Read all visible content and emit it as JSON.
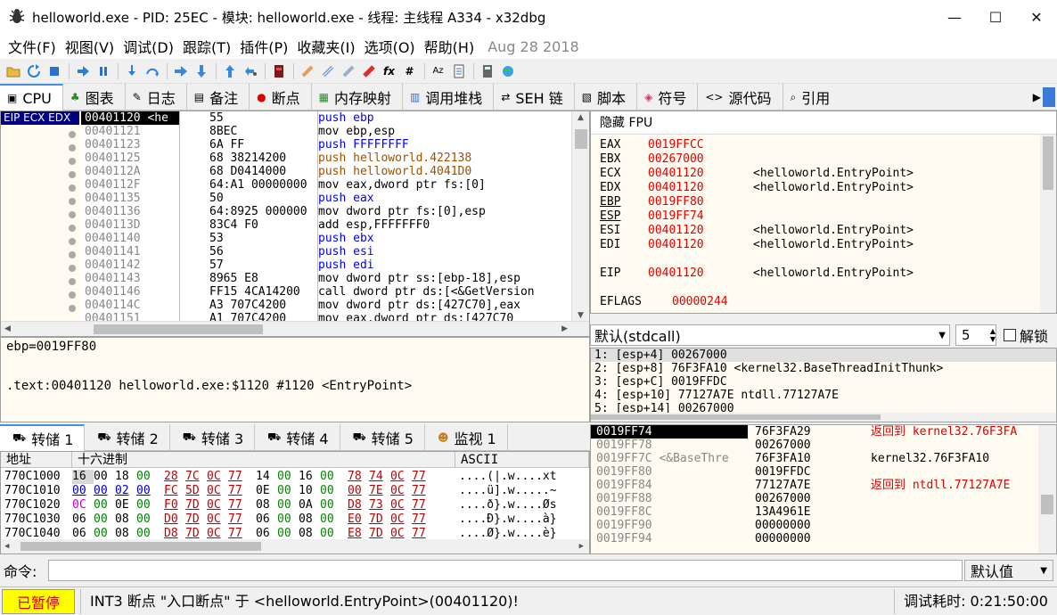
{
  "window": {
    "title": "helloworld.exe - PID: 25EC - 模块: helloworld.exe - 线程: 主线程 A334 - x32dbg",
    "minimize": "—",
    "maximize": "☐",
    "close": "✕"
  },
  "menu": {
    "items": [
      "文件(F)",
      "视图(V)",
      "调试(D)",
      "跟踪(T)",
      "插件(P)",
      "收藏夹(I)",
      "选项(O)",
      "帮助(H)"
    ],
    "date": "Aug 28 2018"
  },
  "toolbar": {
    "fx": "fx",
    "hash": "#",
    "az": "Aᴢ"
  },
  "tabs": [
    {
      "label": "CPU",
      "icon": "▣"
    },
    {
      "label": "图表",
      "icon": "♣"
    },
    {
      "label": "日志",
      "icon": "✎"
    },
    {
      "label": "备注",
      "icon": "▤"
    },
    {
      "label": "断点",
      "icon": "●"
    },
    {
      "label": "内存映射",
      "icon": "▦"
    },
    {
      "label": "调用堆栈",
      "icon": "▥"
    },
    {
      "label": "SEH 链",
      "icon": "⇄"
    },
    {
      "label": "脚本",
      "icon": "▧"
    },
    {
      "label": "符号",
      "icon": "◈"
    },
    {
      "label": "源代码",
      "icon": "<>"
    },
    {
      "label": "引用",
      "icon": "⌕"
    }
  ],
  "cpu": {
    "eip_label": "EIP ECX EDX",
    "rows": [
      {
        "addr": "00401120 <he",
        "bytes": "55",
        "asm": "push ebp"
      },
      {
        "addr": "00401121",
        "bytes": "8BEC",
        "asm": "mov ebp,esp"
      },
      {
        "addr": "00401123",
        "bytes": "6A FF",
        "asm": "push FFFFFFFF"
      },
      {
        "addr": "00401125",
        "bytes": "68 38214200",
        "asm": "push helloworld.422138"
      },
      {
        "addr": "0040112A",
        "bytes": "68 D0414000",
        "asm": "push helloworld.4041D0"
      },
      {
        "addr": "0040112F",
        "bytes": "64:A1 00000000",
        "asm": "mov eax,dword ptr fs:[0]"
      },
      {
        "addr": "00401135",
        "bytes": "50",
        "asm": "push eax"
      },
      {
        "addr": "00401136",
        "bytes": "64:8925 000000",
        "asm": "mov dword ptr fs:[0],esp"
      },
      {
        "addr": "0040113D",
        "bytes": "83C4 F0",
        "asm": "add esp,FFFFFFF0"
      },
      {
        "addr": "00401140",
        "bytes": "53",
        "asm": "push ebx"
      },
      {
        "addr": "00401141",
        "bytes": "56",
        "asm": "push esi"
      },
      {
        "addr": "00401142",
        "bytes": "57",
        "asm": "push edi"
      },
      {
        "addr": "00401143",
        "bytes": "8965 E8",
        "asm": "mov dword ptr ss:[ebp-18],esp"
      },
      {
        "addr": "00401146",
        "bytes": "FF15 4CA14200",
        "asm": "call dword ptr ds:[<&GetVersion"
      },
      {
        "addr": "0040114C",
        "bytes": "A3 707C4200",
        "asm": "mov dword ptr ds:[427C70],eax"
      },
      {
        "addr": "00401151",
        "bytes": "A1 707C4200",
        "asm": "mov eax,dword ptr ds:[427C70"
      }
    ]
  },
  "info": {
    "line1": "ebp=0019FF80",
    "line2": ".text:00401120 helloworld.exe:$1120 #1120 <EntryPoint>"
  },
  "registers": {
    "header": "隐藏 FPU",
    "list": [
      {
        "name": "EAX",
        "value": "0019FFCC",
        "comment": ""
      },
      {
        "name": "EBX",
        "value": "00267000",
        "comment": ""
      },
      {
        "name": "ECX",
        "value": "00401120",
        "comment": "<helloworld.EntryPoint>"
      },
      {
        "name": "EDX",
        "value": "00401120",
        "comment": "<helloworld.EntryPoint>"
      },
      {
        "name": "EBP",
        "value": "0019FF80",
        "comment": ""
      },
      {
        "name": "ESP",
        "value": "0019FF74",
        "comment": ""
      },
      {
        "name": "ESI",
        "value": "00401120",
        "comment": "<helloworld.EntryPoint>"
      },
      {
        "name": "EDI",
        "value": "00401120",
        "comment": "<helloworld.EntryPoint>"
      },
      {
        "name": "EIP",
        "value": "00401120",
        "comment": "<helloworld.EntryPoint>"
      },
      {
        "name": "EFLAGS",
        "value": "00000244",
        "comment": ""
      }
    ]
  },
  "callconv": {
    "selected": "默认(stdcall)",
    "count": "5",
    "unlock": "解锁"
  },
  "args": [
    "1: [esp+4] 00267000",
    "2: [esp+8] 76F3FA10 <kernel32.BaseThreadInitThunk>",
    "3: [esp+C] 0019FFDC",
    "4: [esp+10] 77127A7E ntdll.77127A7E",
    "5: [esp+14] 00267000"
  ],
  "dump_tabs": [
    {
      "label": "转储 1"
    },
    {
      "label": "转储 2"
    },
    {
      "label": "转储 3"
    },
    {
      "label": "转储 4"
    },
    {
      "label": "转储 5"
    },
    {
      "label": "监视 1"
    }
  ],
  "dump": {
    "col_addr": "地址",
    "col_hex": "十六进制",
    "col_ascii": "ASCII",
    "rows": [
      {
        "addr": "770C1000",
        "ascii": "....(|.w....xt"
      },
      {
        "addr": "770C1010",
        "ascii": "....ü].w.....~"
      },
      {
        "addr": "770C1020",
        "ascii": "....ð}.w....Øs"
      },
      {
        "addr": "770C1030",
        "ascii": "....Ð}.w....à}"
      },
      {
        "addr": "770C1040",
        "ascii": "....Ø}.w....è}"
      }
    ],
    "hex": [
      [
        [
          "16",
          "g"
        ],
        [
          "00",
          "g"
        ],
        [
          "18",
          "n"
        ],
        [
          "00",
          "b"
        ],
        [
          "28",
          "r"
        ],
        [
          "7C",
          "r"
        ],
        [
          "0C",
          "r"
        ],
        [
          "77",
          "r"
        ],
        [
          "14",
          "n"
        ],
        [
          "00",
          "b"
        ],
        [
          "16",
          "n"
        ],
        [
          "00",
          "b"
        ],
        [
          "78",
          "r"
        ],
        [
          "74",
          "r"
        ],
        [
          "0C",
          "r"
        ],
        [
          "77",
          "r"
        ]
      ],
      [
        [
          "00",
          "u"
        ],
        [
          "00",
          "u"
        ],
        [
          "02",
          "u"
        ],
        [
          "00",
          "u"
        ],
        [
          "FC",
          "r"
        ],
        [
          "5D",
          "r"
        ],
        [
          "0C",
          "r"
        ],
        [
          "77",
          "r"
        ],
        [
          "0E",
          "n"
        ],
        [
          "00",
          "b"
        ],
        [
          "10",
          "n"
        ],
        [
          "00",
          "b"
        ],
        [
          "00",
          "r"
        ],
        [
          "7E",
          "r"
        ],
        [
          "0C",
          "r"
        ],
        [
          "77",
          "r"
        ]
      ],
      [
        [
          "0C",
          "q"
        ],
        [
          "00",
          "b"
        ],
        [
          "0E",
          "n"
        ],
        [
          "00",
          "b"
        ],
        [
          "F0",
          "r"
        ],
        [
          "7D",
          "r"
        ],
        [
          "0C",
          "r"
        ],
        [
          "77",
          "r"
        ],
        [
          "08",
          "n"
        ],
        [
          "00",
          "b"
        ],
        [
          "0A",
          "n"
        ],
        [
          "00",
          "b"
        ],
        [
          "D8",
          "r"
        ],
        [
          "73",
          "r"
        ],
        [
          "0C",
          "r"
        ],
        [
          "77",
          "r"
        ]
      ],
      [
        [
          "06",
          "n"
        ],
        [
          "00",
          "b"
        ],
        [
          "08",
          "n"
        ],
        [
          "00",
          "b"
        ],
        [
          "D0",
          "r"
        ],
        [
          "7D",
          "r"
        ],
        [
          "0C",
          "r"
        ],
        [
          "77",
          "r"
        ],
        [
          "06",
          "n"
        ],
        [
          "00",
          "b"
        ],
        [
          "08",
          "n"
        ],
        [
          "00",
          "b"
        ],
        [
          "E0",
          "r"
        ],
        [
          "7D",
          "r"
        ],
        [
          "0C",
          "r"
        ],
        [
          "77",
          "r"
        ]
      ],
      [
        [
          "06",
          "n"
        ],
        [
          "00",
          "b"
        ],
        [
          "08",
          "n"
        ],
        [
          "00",
          "b"
        ],
        [
          "D8",
          "r"
        ],
        [
          "7D",
          "r"
        ],
        [
          "0C",
          "r"
        ],
        [
          "77",
          "r"
        ],
        [
          "06",
          "n"
        ],
        [
          "00",
          "b"
        ],
        [
          "08",
          "n"
        ],
        [
          "00",
          "b"
        ],
        [
          "E8",
          "r"
        ],
        [
          "7D",
          "r"
        ],
        [
          "0C",
          "r"
        ],
        [
          "77",
          "r"
        ]
      ]
    ]
  },
  "stack": {
    "rows": [
      {
        "addr": "0019FF74",
        "val": "76F3FA29",
        "comment": "返回到 kernel32.76F3FA",
        "red": true
      },
      {
        "addr": "0019FF78",
        "val": "00267000",
        "comment": "",
        "red": false
      },
      {
        "addr": "0019FF7C <&BaseThre",
        "val": "76F3FA10",
        "comment": "kernel32.76F3FA10",
        "red": false
      },
      {
        "addr": "0019FF80",
        "val": "0019FFDC",
        "comment": "",
        "red": false
      },
      {
        "addr": "0019FF84",
        "val": "77127A7E",
        "comment": "返回到 ntdll.77127A7E",
        "red": true
      },
      {
        "addr": "0019FF88",
        "val": "00267000",
        "comment": "",
        "red": false
      },
      {
        "addr": "0019FF8C",
        "val": "13A4961E",
        "comment": "",
        "red": false
      },
      {
        "addr": "0019FF90",
        "val": "00000000",
        "comment": "",
        "red": false
      },
      {
        "addr": "0019FF94",
        "val": "00000000",
        "comment": "",
        "red": false
      }
    ]
  },
  "command": {
    "label": "命令:",
    "value": "",
    "default": "默认值"
  },
  "status": {
    "paused": "已暂停",
    "message": "INT3 断点 \"入口断点\" 于 <helloworld.EntryPoint>(00401120)!",
    "time": "调试耗时:   0:21:50:00"
  }
}
